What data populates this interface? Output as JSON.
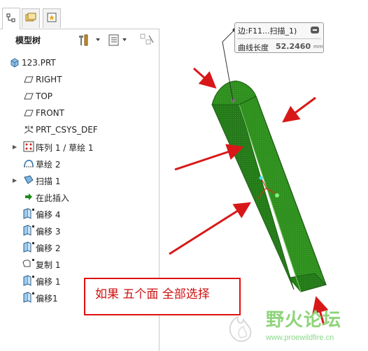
{
  "panel": {
    "tabs": [
      {
        "name": "model-tree-tab",
        "icon": "hierarchy-icon"
      },
      {
        "name": "folder-tab",
        "icon": "folder-browser-icon"
      },
      {
        "name": "favorites-tab",
        "icon": "favorites-icon"
      }
    ],
    "tree_title": "模型树",
    "toolbar_icons": [
      "tools-icon",
      "settings-list-icon",
      "filter-icon"
    ]
  },
  "tree": {
    "items": [
      {
        "label": "123.PRT",
        "icon": "part-icon",
        "expandable": false
      },
      {
        "label": "RIGHT",
        "icon": "datum-plane-icon",
        "expandable": false
      },
      {
        "label": "TOP",
        "icon": "datum-plane-icon",
        "expandable": false
      },
      {
        "label": "FRONT",
        "icon": "datum-plane-icon",
        "expandable": false
      },
      {
        "label": "PRT_CSYS_DEF",
        "icon": "coordinate-system-icon",
        "expandable": false
      },
      {
        "label": "阵列 1 / 草绘 1",
        "icon": "pattern-icon",
        "expandable": true
      },
      {
        "label": "草绘 2",
        "icon": "sketch-icon",
        "expandable": false
      },
      {
        "label": "扫描 1",
        "icon": "sweep-icon",
        "expandable": true
      },
      {
        "label": "在此插入",
        "icon": "insert-here-arrow-icon",
        "expandable": false
      },
      {
        "label": "偏移 4",
        "icon": "offset-surface-icon",
        "expandable": false
      },
      {
        "label": "偏移 3",
        "icon": "offset-surface-icon",
        "expandable": false
      },
      {
        "label": "偏移 2",
        "icon": "offset-surface-icon",
        "expandable": false
      },
      {
        "label": "复制 1",
        "icon": "copy-surface-icon",
        "expandable": false
      },
      {
        "label": "偏移 1",
        "icon": "offset-surface-icon",
        "expandable": false
      },
      {
        "label": "偏移1",
        "icon": "offset-surface-icon",
        "expandable": false
      }
    ]
  },
  "tooltip": {
    "edge": "边:F11...扫描_1)",
    "label": "曲线长度",
    "value": "52.2460",
    "unit": "mm"
  },
  "annotation": {
    "text": "如果  五个面  全部选择"
  },
  "watermark": {
    "title": "野火论坛",
    "url": "www.proewildfire.cn"
  },
  "colors": {
    "model_green": "#2e8a1e",
    "arrow_red": "#d81818",
    "panel_border": "#c9c9c9"
  }
}
